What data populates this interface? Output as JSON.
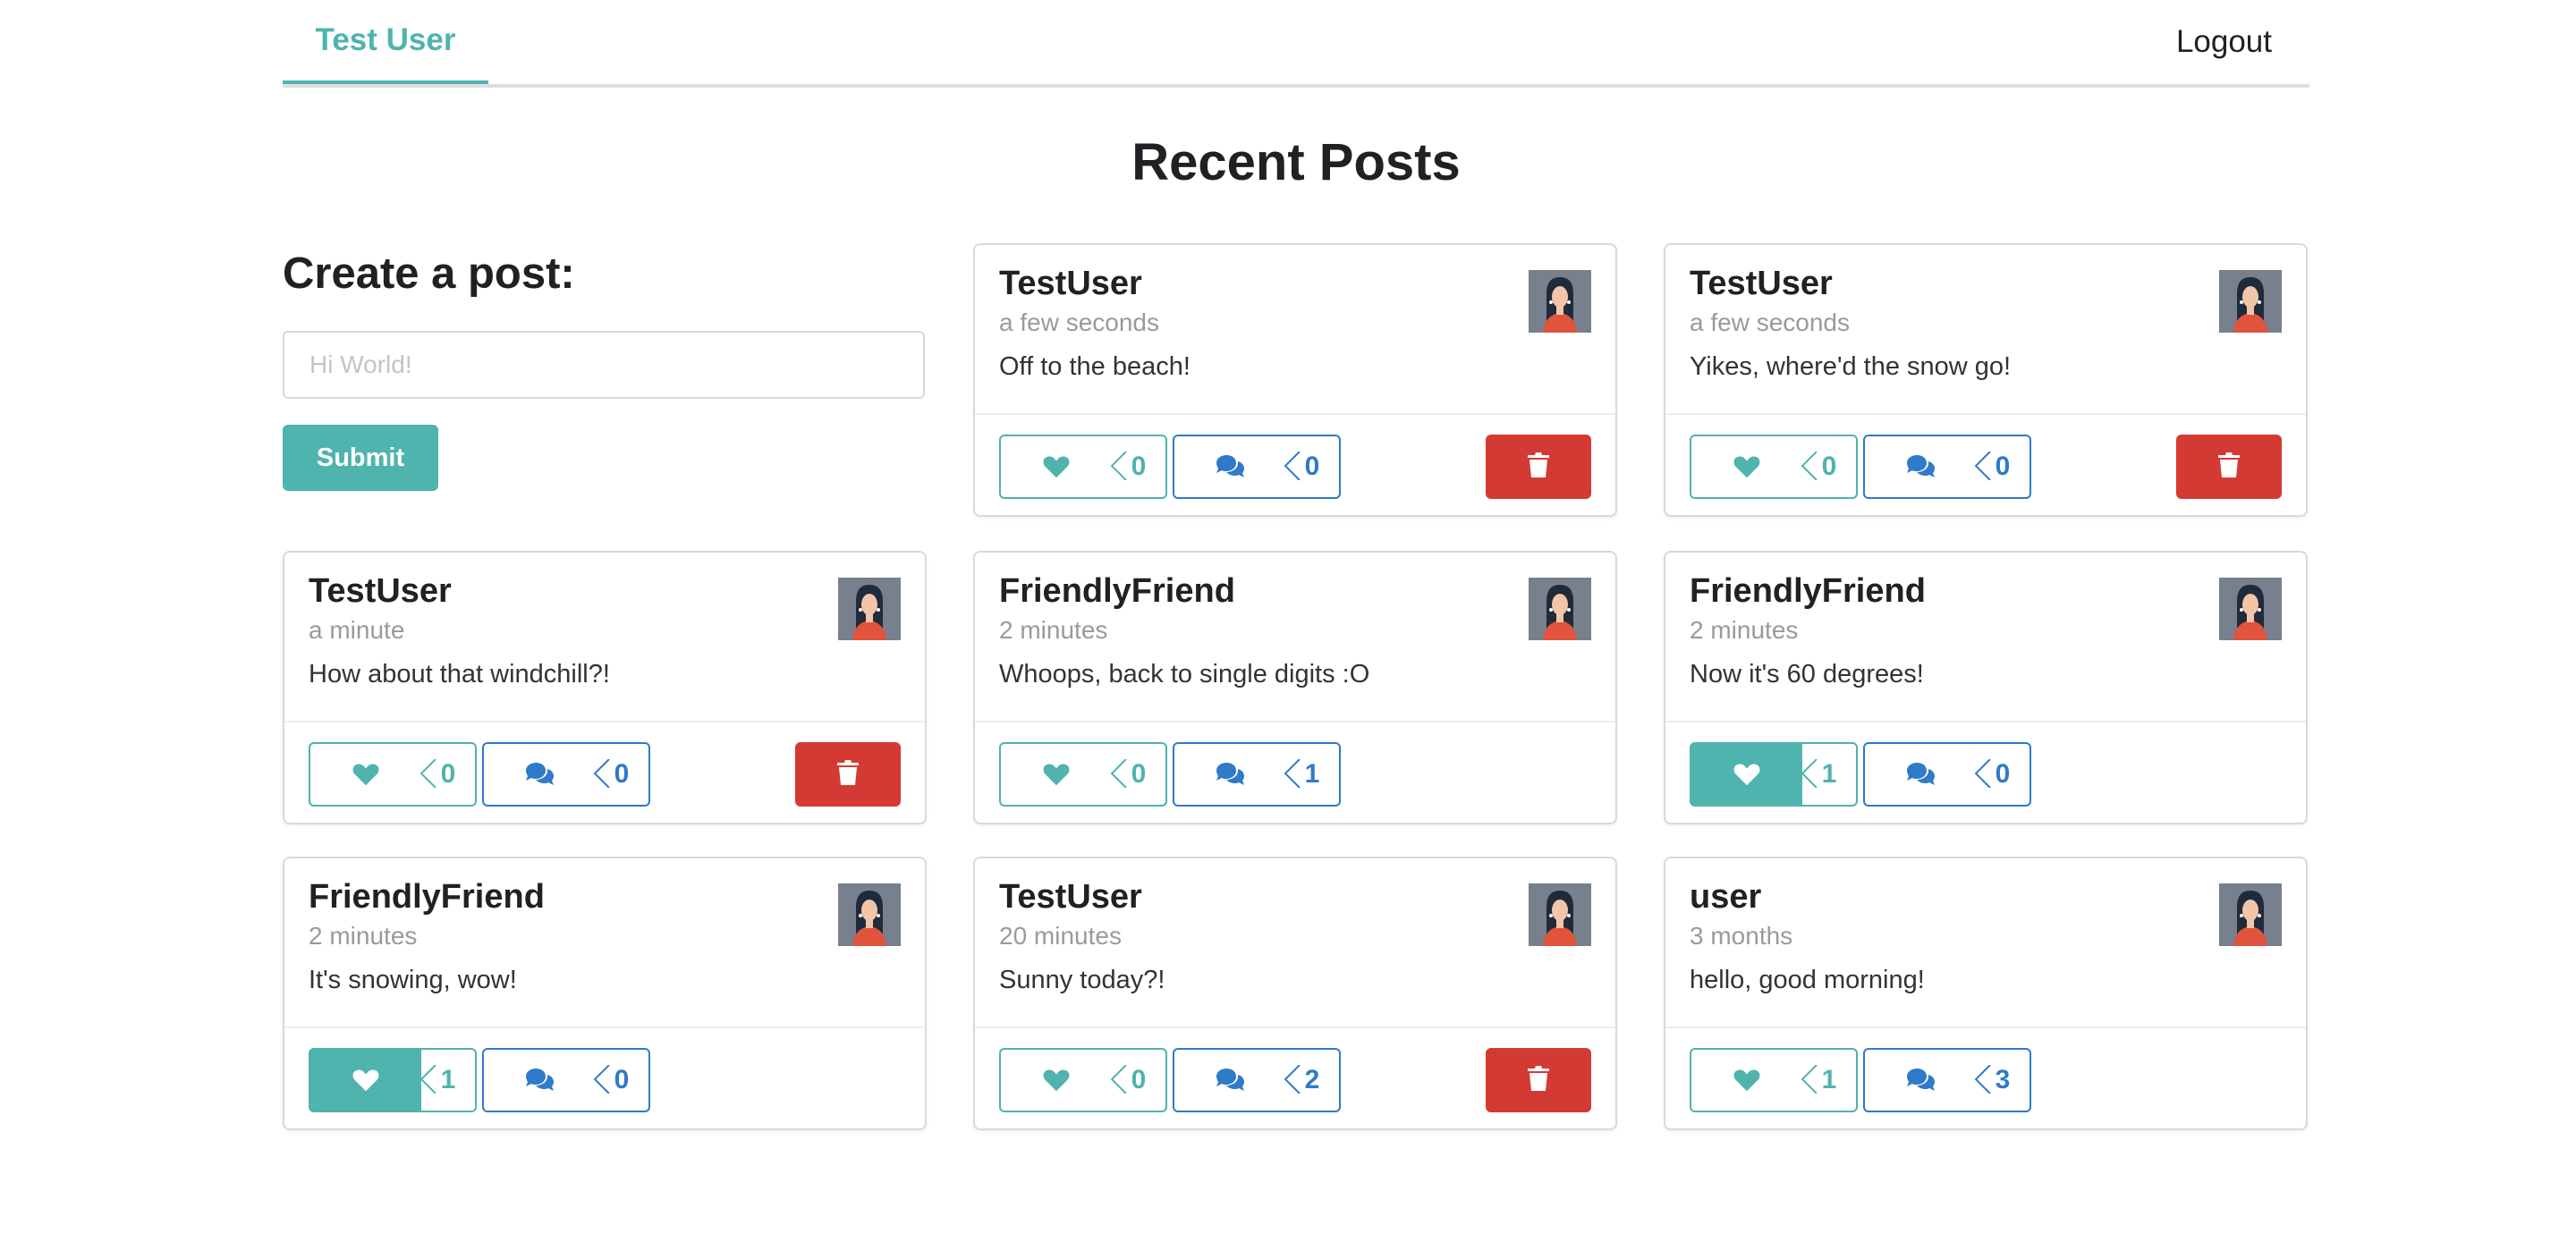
{
  "header": {
    "user_label": "Test User",
    "logout_label": "Logout"
  },
  "page_title": "Recent Posts",
  "create_post": {
    "title": "Create a post:",
    "placeholder": "Hi World!",
    "submit_label": "Submit"
  },
  "colors": {
    "teal": "#4fb3ae",
    "blue": "#2f7ac9",
    "red": "#d33a33"
  },
  "posts": [
    {
      "author": "TestUser",
      "time": "a few seconds",
      "body": "Off to the beach!",
      "likes": "0",
      "comments": "0",
      "liked": false,
      "deletable": true
    },
    {
      "author": "TestUser",
      "time": "a few seconds",
      "body": "Yikes, where'd the snow go!",
      "likes": "0",
      "comments": "0",
      "liked": false,
      "deletable": true
    },
    {
      "author": "TestUser",
      "time": "a minute",
      "body": "How about that windchill?!",
      "likes": "0",
      "comments": "0",
      "liked": false,
      "deletable": true
    },
    {
      "author": "FriendlyFriend",
      "time": "2 minutes",
      "body": "Whoops, back to single digits :O",
      "likes": "0",
      "comments": "1",
      "liked": false,
      "deletable": false
    },
    {
      "author": "FriendlyFriend",
      "time": "2 minutes",
      "body": "Now it's 60 degrees!",
      "likes": "1",
      "comments": "0",
      "liked": true,
      "deletable": false
    },
    {
      "author": "FriendlyFriend",
      "time": "2 minutes",
      "body": "It's snowing, wow!",
      "likes": "1",
      "comments": "0",
      "liked": true,
      "deletable": false
    },
    {
      "author": "TestUser",
      "time": "20 minutes",
      "body": "Sunny today?!",
      "likes": "0",
      "comments": "2",
      "liked": false,
      "deletable": true
    },
    {
      "author": "user",
      "time": "3 months",
      "body": "hello, good morning!",
      "likes": "1",
      "comments": "3",
      "liked": false,
      "deletable": false
    }
  ]
}
